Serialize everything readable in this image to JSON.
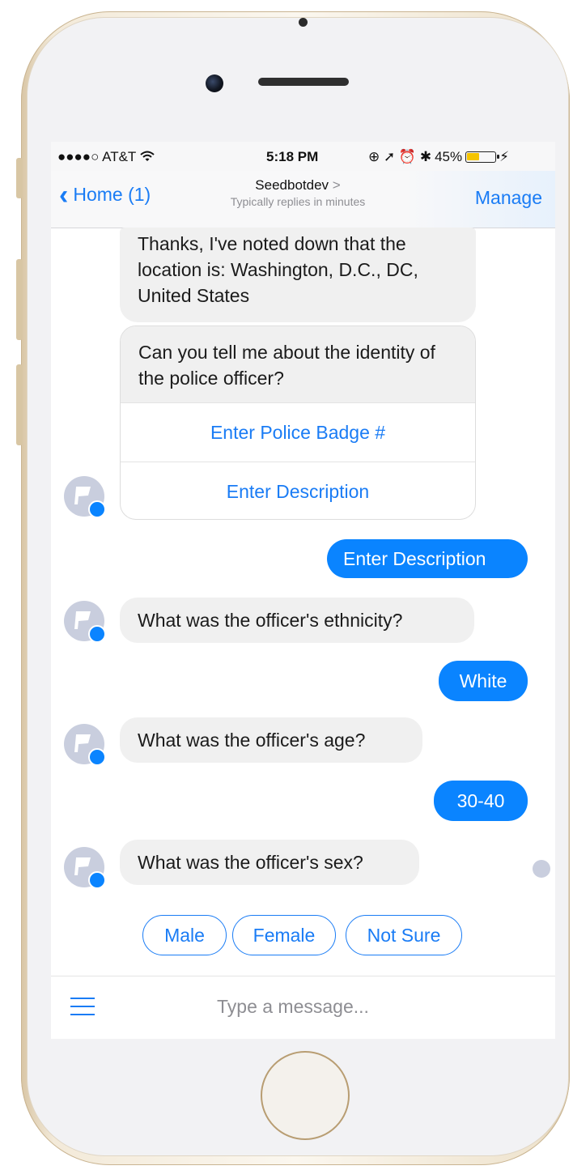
{
  "status_bar": {
    "carrier": "●●●●○ AT&T",
    "wifi_icon": "wifi-icon",
    "time": "5:18 PM",
    "indicators": "⊕ ➚ ⏰ ✱",
    "battery_percent": "45%",
    "battery_level": 0.45
  },
  "nav": {
    "back_label": "Home (1)",
    "title": "Seedbotdev",
    "title_chevron": ">",
    "subtitle": "Typically replies in minutes",
    "manage_label": "Manage"
  },
  "messages": {
    "m1": "Thanks, I've noted down that the location is: Washington, D.C., DC, United States",
    "card_text": "Can you tell me about the identity of the police officer?",
    "card_button_1": "Enter Police Badge #",
    "card_button_2": "Enter Description",
    "reply_1": "Enter Description",
    "m2": "What was the officer's ethnicity?",
    "reply_2": "White",
    "m3": "What was the officer's age?",
    "reply_3": "30-40",
    "m4": "What was the officer's sex?"
  },
  "quick_replies": [
    "Male",
    "Female",
    "Not Sure"
  ],
  "composer": {
    "placeholder": "Type a message..."
  },
  "colors": {
    "accent": "#1a7cf5",
    "outgoing_bubble": "#0a84ff",
    "incoming_bubble": "#f0f0f0"
  }
}
